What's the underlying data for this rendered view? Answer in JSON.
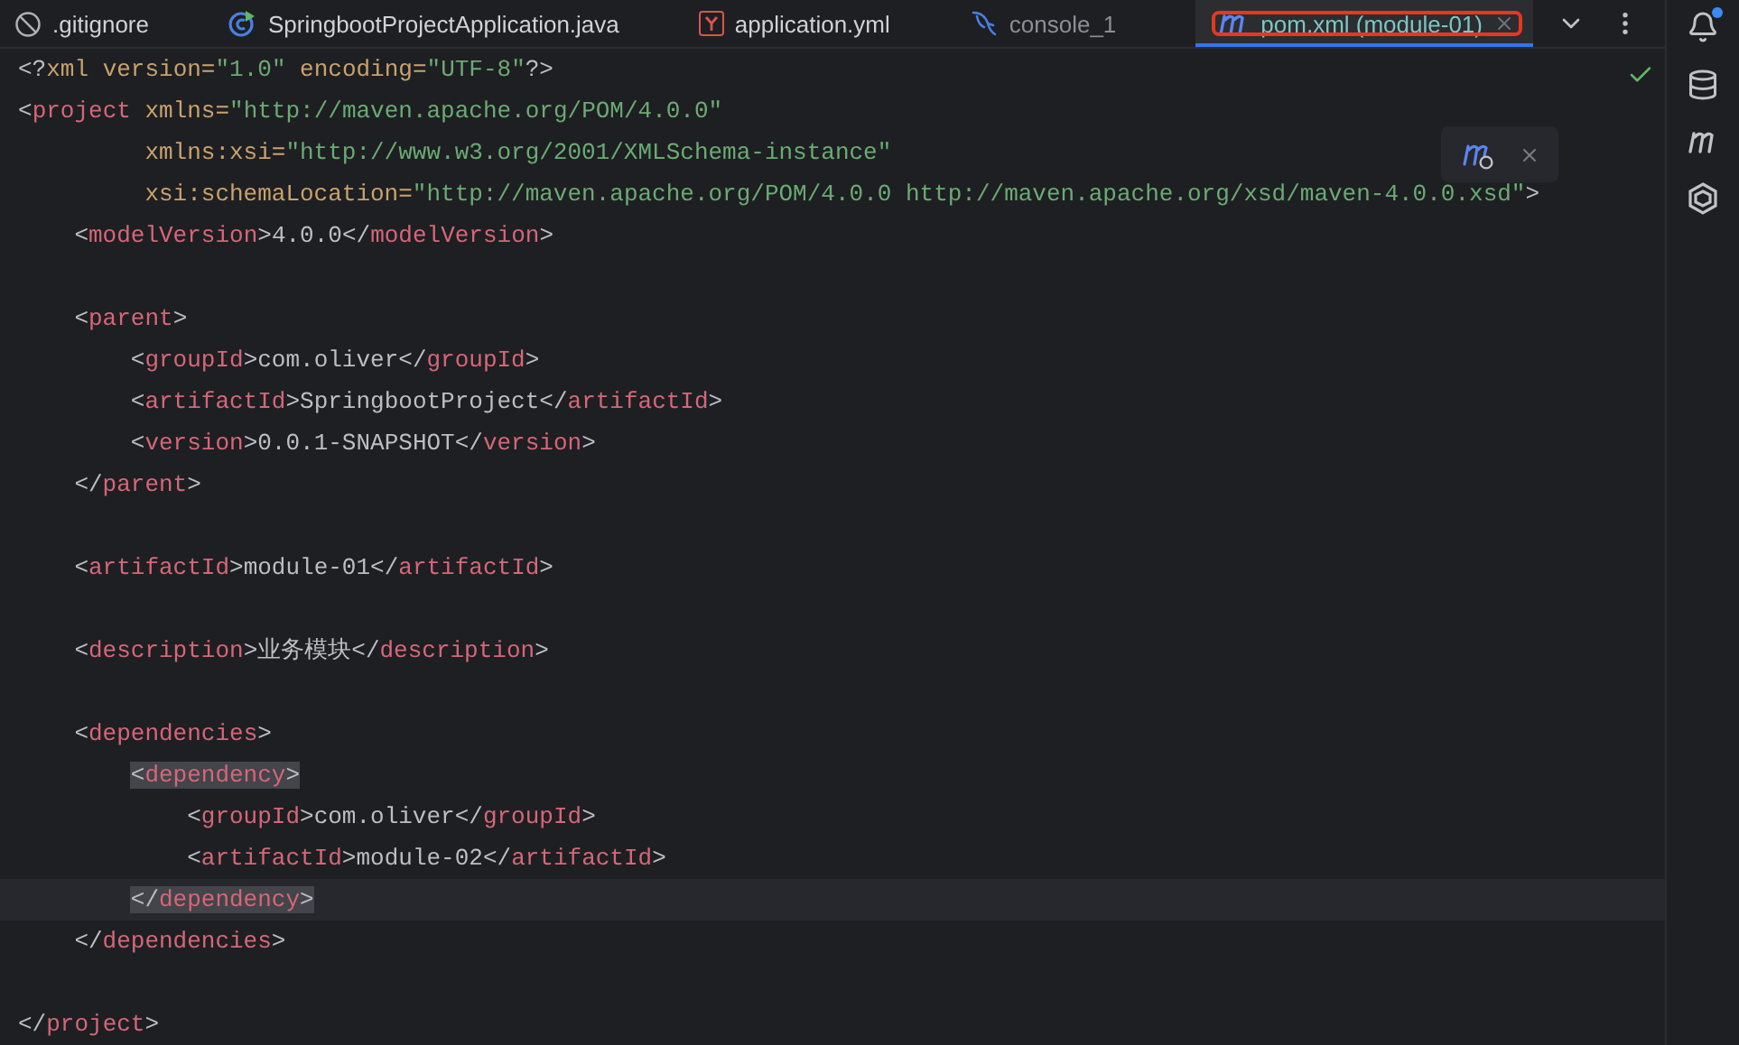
{
  "tabs": [
    {
      "kind": "ignore",
      "label": ".gitignore",
      "selected": false
    },
    {
      "kind": "java",
      "label": "SpringbootProjectApplication.java",
      "selected": false
    },
    {
      "kind": "yaml",
      "label": "application.yml",
      "selected": false
    },
    {
      "kind": "console",
      "label": "console_1",
      "selected": false
    },
    {
      "kind": "maven",
      "label": "pom.xml (module-01)",
      "selected": true,
      "outlined": true
    }
  ],
  "editor": {
    "lines": [
      {
        "kind": "code",
        "tokens": [
          {
            "kind": "punct",
            "text": "<?"
          },
          {
            "kind": "attr",
            "text": "xml version="
          },
          {
            "kind": "string",
            "text": "\"1.0\""
          },
          {
            "kind": "attr",
            "text": " encoding="
          },
          {
            "kind": "string",
            "text": "\"UTF-8\""
          },
          {
            "kind": "punct",
            "text": "?>"
          }
        ]
      },
      {
        "kind": "code",
        "tokens": [
          {
            "kind": "punct",
            "text": "<"
          },
          {
            "kind": "tag",
            "text": "project"
          },
          {
            "kind": "attr",
            "text": " xmlns="
          },
          {
            "kind": "string",
            "text": "\"http://maven.apache.org/POM/4.0.0\""
          }
        ],
        "children": [
          {
            "kind": "continuation",
            "tokens": [
              {
                "kind": "attr",
                "text": "xmlns:xsi="
              },
              {
                "kind": "string",
                "text": "\"http://www.w3.org/2001/XMLSchema-instance\""
              }
            ]
          },
          {
            "kind": "continuation",
            "tokens": [
              {
                "kind": "attr",
                "text": "xsi:schemaLocation="
              },
              {
                "kind": "string",
                "text": "\"http://maven.apache.org/POM/4.0.0 http://maven.apache.org/xsd/maven-4.0.0.xsd\""
              },
              {
                "kind": "punct",
                "text": ">"
              }
            ]
          },
          {
            "kind": "code",
            "tokens": [
              {
                "kind": "punct",
                "text": "<"
              },
              {
                "kind": "tag",
                "text": "modelVersion"
              },
              {
                "kind": "punct",
                "text": ">"
              },
              {
                "kind": "text",
                "text": "4.0.0"
              },
              {
                "kind": "punct",
                "text": "</"
              },
              {
                "kind": "tag",
                "text": "modelVersion"
              },
              {
                "kind": "punct",
                "text": ">"
              }
            ]
          },
          {
            "kind": "blank"
          },
          {
            "kind": "code",
            "tokens": [
              {
                "kind": "punct",
                "text": "<"
              },
              {
                "kind": "tag",
                "text": "parent"
              },
              {
                "kind": "punct",
                "text": ">"
              }
            ],
            "children": [
              {
                "kind": "code",
                "tokens": [
                  {
                    "kind": "punct",
                    "text": "<"
                  },
                  {
                    "kind": "tag",
                    "text": "groupId"
                  },
                  {
                    "kind": "punct",
                    "text": ">"
                  },
                  {
                    "kind": "text",
                    "text": "com.oliver"
                  },
                  {
                    "kind": "punct",
                    "text": "</"
                  },
                  {
                    "kind": "tag",
                    "text": "groupId"
                  },
                  {
                    "kind": "punct",
                    "text": ">"
                  }
                ]
              },
              {
                "kind": "code",
                "tokens": [
                  {
                    "kind": "punct",
                    "text": "<"
                  },
                  {
                    "kind": "tag",
                    "text": "artifactId"
                  },
                  {
                    "kind": "punct",
                    "text": ">"
                  },
                  {
                    "kind": "text",
                    "text": "SpringbootProject"
                  },
                  {
                    "kind": "punct",
                    "text": "</"
                  },
                  {
                    "kind": "tag",
                    "text": "artifactId"
                  },
                  {
                    "kind": "punct",
                    "text": ">"
                  }
                ]
              },
              {
                "kind": "code",
                "tokens": [
                  {
                    "kind": "punct",
                    "text": "<"
                  },
                  {
                    "kind": "tag",
                    "text": "version"
                  },
                  {
                    "kind": "punct",
                    "text": ">"
                  },
                  {
                    "kind": "text",
                    "text": "0.0.1-SNAPSHOT"
                  },
                  {
                    "kind": "punct",
                    "text": "</"
                  },
                  {
                    "kind": "tag",
                    "text": "version"
                  },
                  {
                    "kind": "punct",
                    "text": ">"
                  }
                ]
              }
            ]
          },
          {
            "kind": "code",
            "tokens": [
              {
                "kind": "punct",
                "text": "</"
              },
              {
                "kind": "tag",
                "text": "parent"
              },
              {
                "kind": "punct",
                "text": ">"
              }
            ]
          },
          {
            "kind": "blank"
          },
          {
            "kind": "code",
            "tokens": [
              {
                "kind": "punct",
                "text": "<"
              },
              {
                "kind": "tag",
                "text": "artifactId"
              },
              {
                "kind": "punct",
                "text": ">"
              },
              {
                "kind": "text",
                "text": "module-01"
              },
              {
                "kind": "punct",
                "text": "</"
              },
              {
                "kind": "tag",
                "text": "artifactId"
              },
              {
                "kind": "punct",
                "text": ">"
              }
            ]
          },
          {
            "kind": "blank"
          },
          {
            "kind": "code",
            "tokens": [
              {
                "kind": "punct",
                "text": "<"
              },
              {
                "kind": "tag",
                "text": "description"
              },
              {
                "kind": "punct",
                "text": ">"
              },
              {
                "kind": "text",
                "text": "业务模块"
              },
              {
                "kind": "punct",
                "text": "</"
              },
              {
                "kind": "tag",
                "text": "description"
              },
              {
                "kind": "punct",
                "text": ">"
              }
            ]
          },
          {
            "kind": "blank"
          },
          {
            "kind": "code",
            "tokens": [
              {
                "kind": "punct",
                "text": "<"
              },
              {
                "kind": "tag",
                "text": "dependencies"
              },
              {
                "kind": "punct",
                "text": ">"
              }
            ],
            "children": [
              {
                "kind": "code",
                "matched": true,
                "tokens": [
                  {
                    "kind": "punct",
                    "text": "<"
                  },
                  {
                    "kind": "tag",
                    "text": "dependency"
                  },
                  {
                    "kind": "punct",
                    "text": ">"
                  }
                ],
                "children": [
                  {
                    "kind": "code",
                    "tokens": [
                      {
                        "kind": "punct",
                        "text": "<"
                      },
                      {
                        "kind": "tag",
                        "text": "groupId"
                      },
                      {
                        "kind": "punct",
                        "text": ">"
                      },
                      {
                        "kind": "text",
                        "text": "com.oliver"
                      },
                      {
                        "kind": "punct",
                        "text": "</"
                      },
                      {
                        "kind": "tag",
                        "text": "groupId"
                      },
                      {
                        "kind": "punct",
                        "text": ">"
                      }
                    ]
                  },
                  {
                    "kind": "code",
                    "tokens": [
                      {
                        "kind": "punct",
                        "text": "<"
                      },
                      {
                        "kind": "tag",
                        "text": "artifactId"
                      },
                      {
                        "kind": "punct",
                        "text": ">"
                      },
                      {
                        "kind": "text",
                        "text": "module-02"
                      },
                      {
                        "kind": "punct",
                        "text": "</"
                      },
                      {
                        "kind": "tag",
                        "text": "artifactId"
                      },
                      {
                        "kind": "punct",
                        "text": ">"
                      }
                    ]
                  }
                ]
              },
              {
                "kind": "code",
                "matched": true,
                "current": true,
                "tokens": [
                  {
                    "kind": "punct",
                    "text": "</"
                  },
                  {
                    "kind": "tag",
                    "text": "dependency"
                  },
                  {
                    "kind": "punct",
                    "text": ">"
                  }
                ]
              }
            ]
          },
          {
            "kind": "code",
            "tokens": [
              {
                "kind": "punct",
                "text": "</"
              },
              {
                "kind": "tag",
                "text": "dependencies"
              },
              {
                "kind": "punct",
                "text": ">"
              }
            ]
          },
          {
            "kind": "blank"
          }
        ]
      },
      {
        "kind": "code",
        "tokens": [
          {
            "kind": "punct",
            "text": "</"
          },
          {
            "kind": "tag",
            "text": "project"
          },
          {
            "kind": "punct",
            "text": ">"
          }
        ]
      }
    ]
  },
  "notifications": {
    "unread": true
  }
}
